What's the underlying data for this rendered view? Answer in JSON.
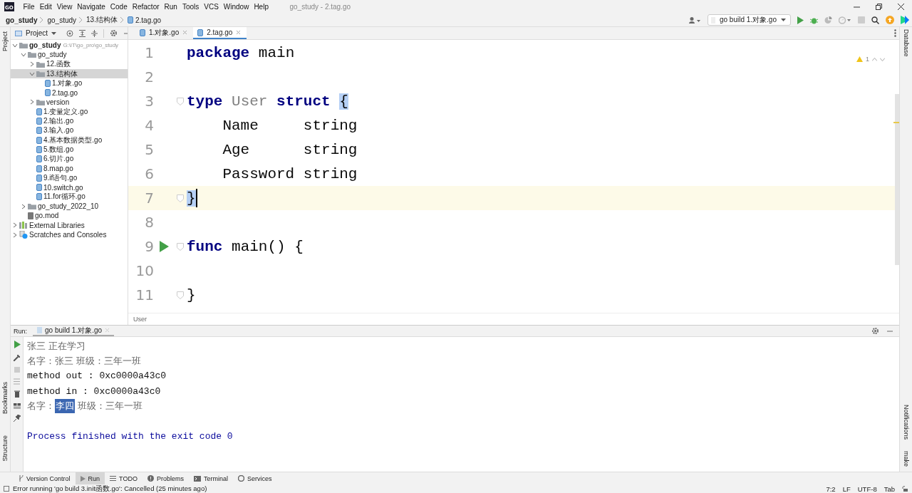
{
  "title_bar": {
    "logo_text": "GO",
    "menu": [
      "File",
      "Edit",
      "View",
      "Navigate",
      "Code",
      "Refactor",
      "Run",
      "Tools",
      "VCS",
      "Window",
      "Help"
    ],
    "title": "go_study - 2.tag.go"
  },
  "navigation_bar": {
    "breadcrumbs": [
      "go_study",
      "go_study",
      "13.结构体",
      "2.tag.go"
    ],
    "run_configuration": "go build 1.对象.go"
  },
  "side_strips": {
    "left_top": [
      "Project"
    ],
    "left_bottom": [
      "Bookmarks",
      "Structure"
    ],
    "right_top": [
      "Database"
    ],
    "right_bottom": [
      "Notifications",
      "make"
    ]
  },
  "project_panel": {
    "title": "Project",
    "tree": [
      {
        "label": "go_study",
        "path": "G:\\IT\\go_pro\\go_study",
        "kind": "folder",
        "expanded": true,
        "selected": false,
        "children": [
          {
            "label": "go_study",
            "kind": "folder",
            "expanded": true,
            "selected": false,
            "children": [
              {
                "label": "12.函数",
                "kind": "folder",
                "expanded": false,
                "selected": false
              },
              {
                "label": "13.结构体",
                "kind": "folder",
                "expanded": true,
                "selected": true,
                "children": [
                  {
                    "label": "1.对象.go",
                    "kind": "file",
                    "selected": false
                  },
                  {
                    "label": "2.tag.go",
                    "kind": "file",
                    "selected": false
                  }
                ]
              },
              {
                "label": "version",
                "kind": "folder",
                "expanded": false,
                "selected": false
              },
              {
                "label": "1.变量定义.go",
                "kind": "file",
                "selected": false
              },
              {
                "label": "2.输出.go",
                "kind": "file",
                "selected": false
              },
              {
                "label": "3.输入.go",
                "kind": "file",
                "selected": false
              },
              {
                "label": "4.基本数据类型.go",
                "kind": "file",
                "selected": false
              },
              {
                "label": "5.数组.go",
                "kind": "file",
                "selected": false
              },
              {
                "label": "6.切片.go",
                "kind": "file",
                "selected": false
              },
              {
                "label": "8.map.go",
                "kind": "file",
                "selected": false
              },
              {
                "label": "9.if语句.go",
                "kind": "file",
                "selected": false
              },
              {
                "label": "10.switch.go",
                "kind": "file",
                "selected": false
              },
              {
                "label": "11.for循环.go",
                "kind": "file",
                "selected": false
              }
            ]
          },
          {
            "label": "go_study_2022_10",
            "kind": "folder",
            "expanded": false,
            "selected": false
          },
          {
            "label": "go.mod",
            "kind": "mod",
            "selected": false
          }
        ]
      },
      {
        "label": "External Libraries",
        "kind": "library",
        "expanded": false,
        "selected": false
      },
      {
        "label": "Scratches and Consoles",
        "kind": "scratches",
        "expanded": false,
        "selected": false
      }
    ]
  },
  "editor": {
    "tabs": [
      {
        "label": "1.对象.go",
        "selected": false
      },
      {
        "label": "2.tag.go",
        "selected": true
      }
    ],
    "warnings": "1",
    "lines": [
      {
        "number": "1",
        "current": false,
        "run_marker": false,
        "fold": false,
        "tokens": [
          {
            "text": "package",
            "kind": "keyword"
          },
          {
            "text": " main",
            "kind": "plain"
          }
        ]
      },
      {
        "number": "2",
        "current": false,
        "run_marker": false,
        "fold": false
      },
      {
        "number": "3",
        "current": false,
        "run_marker": false,
        "fold": true,
        "tokens": [
          {
            "text": "type",
            "kind": "keyword"
          },
          {
            "text": " User",
            "kind": "unused"
          },
          {
            "text": " struct ",
            "kind": "keyword"
          },
          {
            "text": "{",
            "kind": "brace_match"
          }
        ]
      },
      {
        "number": "4",
        "current": false,
        "run_marker": false,
        "fold": false,
        "tokens": [
          {
            "text": "    Name     string",
            "kind": "plain"
          }
        ]
      },
      {
        "number": "5",
        "current": false,
        "run_marker": false,
        "fold": false,
        "tokens": [
          {
            "text": "    Age      string",
            "kind": "plain"
          }
        ]
      },
      {
        "number": "6",
        "current": false,
        "run_marker": false,
        "fold": false,
        "tokens": [
          {
            "text": "    Password string",
            "kind": "plain"
          }
        ]
      },
      {
        "number": "7",
        "current": true,
        "run_marker": false,
        "fold": true,
        "tokens": [
          {
            "text": "}",
            "kind": "brace_match"
          }
        ]
      },
      {
        "number": "8",
        "current": false,
        "run_marker": false,
        "fold": false
      },
      {
        "number": "9",
        "current": false,
        "run_marker": true,
        "fold": true,
        "tokens": [
          {
            "text": "func",
            "kind": "keyword"
          },
          {
            "text": " main() {",
            "kind": "plain"
          }
        ]
      },
      {
        "number": "10",
        "current": false,
        "run_marker": false,
        "fold": false
      },
      {
        "number": "11",
        "current": false,
        "run_marker": false,
        "fold": true,
        "tokens": [
          {
            "text": "}",
            "kind": "plain"
          }
        ]
      }
    ],
    "breadcrumb": "User"
  },
  "run_panel": {
    "label": "Run:",
    "tab": "go build 1.对象.go",
    "output": [
      {
        "kind": "cjk",
        "segments": [
          {
            "text": "张三 正在学习",
            "selected": false
          }
        ]
      },
      {
        "kind": "cjk",
        "segments": [
          {
            "text": "名字：张三 班级：三年一班",
            "selected": false
          }
        ]
      },
      {
        "kind": "plain",
        "segments": [
          {
            "text": "method out : 0xc0000a43c0",
            "selected": false
          }
        ]
      },
      {
        "kind": "plain",
        "segments": [
          {
            "text": "method in : 0xc0000a43c0",
            "selected": false
          }
        ]
      },
      {
        "kind": "cjk",
        "segments": [
          {
            "text": "名字：",
            "selected": false
          },
          {
            "text": "李四",
            "selected": true
          },
          {
            "text": " 班级：三年一班",
            "selected": false
          }
        ]
      },
      {
        "kind": "exit",
        "segments": [
          {
            "text": "Process finished with the exit code 0",
            "selected": false
          }
        ]
      }
    ]
  },
  "tool_tabs": [
    {
      "label": "Version Control",
      "selected": false
    },
    {
      "label": "Run",
      "selected": true
    },
    {
      "label": "TODO",
      "selected": false
    },
    {
      "label": "Problems",
      "selected": false
    },
    {
      "label": "Terminal",
      "selected": false
    },
    {
      "label": "Services",
      "selected": false
    }
  ],
  "status_bar": {
    "message": "Error running 'go build 3.init函数.go': Cancelled (25 minutes ago)",
    "items": [
      "7:2",
      "LF",
      "UTF-8",
      "Tab"
    ]
  }
}
